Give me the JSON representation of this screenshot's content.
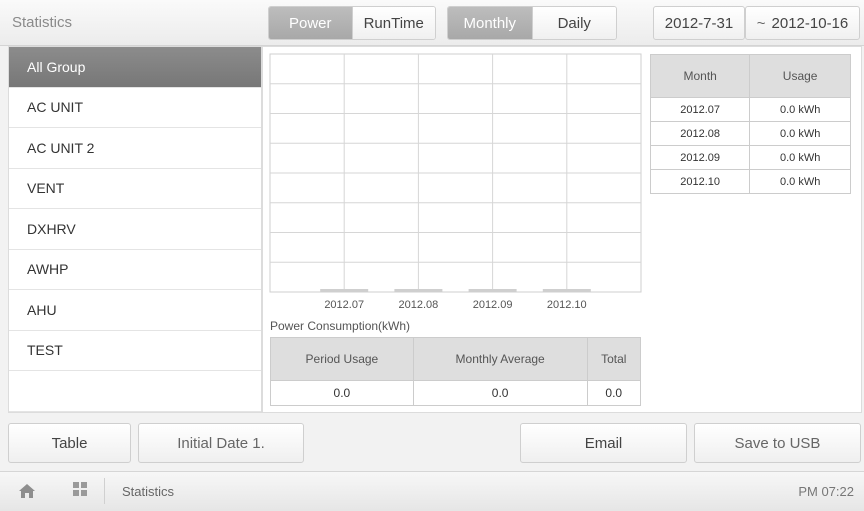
{
  "app": {
    "title": "Statistics"
  },
  "header": {
    "type_tabs": [
      {
        "label": "Power",
        "active": true
      },
      {
        "label": "RunTime",
        "active": false
      }
    ],
    "period_tabs": [
      {
        "label": "Monthly",
        "active": true
      },
      {
        "label": "Daily",
        "active": false
      }
    ],
    "date_start": "2012-7-31",
    "date_separator": "~",
    "date_end": "2012-10-16"
  },
  "sidebar": {
    "items": [
      {
        "label": "All Group",
        "selected": true
      },
      {
        "label": "AC UNIT"
      },
      {
        "label": "AC UNIT 2"
      },
      {
        "label": "VENT"
      },
      {
        "label": "DXHRV"
      },
      {
        "label": "AWHP"
      },
      {
        "label": "AHU"
      },
      {
        "label": "TEST"
      },
      {
        "label": ""
      }
    ]
  },
  "chart_data": {
    "type": "bar",
    "categories": [
      "2012.07",
      "2012.08",
      "2012.09",
      "2012.10"
    ],
    "values": [
      0.0,
      0.0,
      0.0,
      0.0
    ],
    "title": "Power Consumption(kWh)",
    "xlabel": "",
    "ylabel": "",
    "grid": true
  },
  "summary": {
    "headers": [
      "Period Usage",
      "Monthly Average",
      "Total"
    ],
    "values": [
      "0.0",
      "0.0",
      "0.0"
    ]
  },
  "monthly_table": {
    "headers": [
      "Month",
      "Usage"
    ],
    "rows": [
      [
        "2012.07",
        "0.0 kWh"
      ],
      [
        "2012.08",
        "0.0 kWh"
      ],
      [
        "2012.09",
        "0.0 kWh"
      ],
      [
        "2012.10",
        "0.0 kWh"
      ]
    ]
  },
  "footer": {
    "table_button": "Table",
    "initial_date_button": "Initial Date 1.",
    "email_button": "Email",
    "usb_button": "Save to USB"
  },
  "status": {
    "label": "Statistics",
    "time": "PM 07:22"
  },
  "colors": {
    "active_tab": "#a8a8a8",
    "selected_item": "#808080",
    "bar": "#cfcfcf"
  }
}
